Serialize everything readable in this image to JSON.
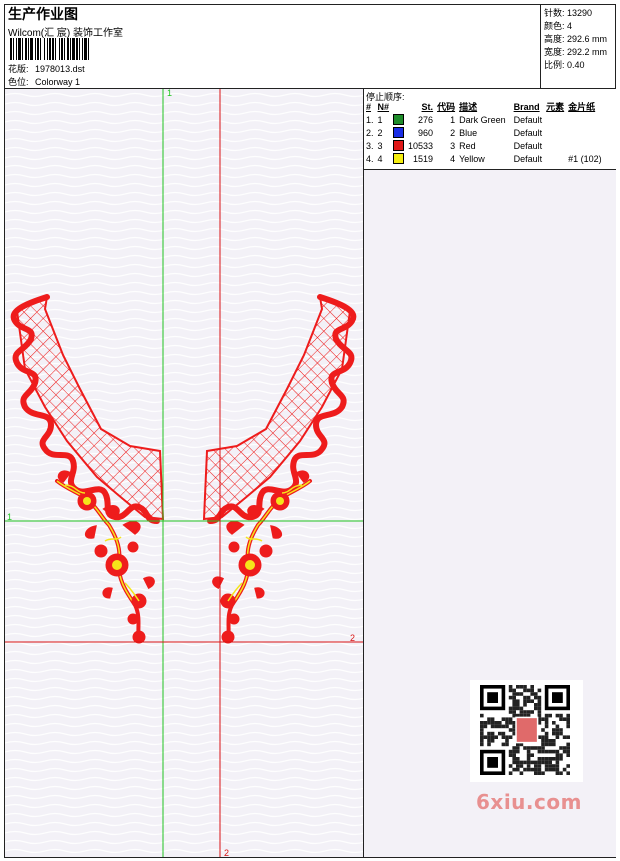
{
  "header": {
    "title": "生产作业图",
    "studio": "Wilcom(汇 宸) 装饰工作室",
    "design_label": "花版:",
    "design_value": "1978013.dst",
    "colorway_label": "色位:",
    "colorway_value": "Colorway 1"
  },
  "stats": {
    "stitches_label": "针数:",
    "stitches": "13290",
    "colors_label": "颜色:",
    "colors": "4",
    "height_label": "高度:",
    "height": "292.6 mm",
    "width_label": "宽度:",
    "width": "292.2 mm",
    "scale_label": "比例:",
    "scale": "0.40"
  },
  "stop_sequence": {
    "title": "停止顺序:",
    "headers": [
      "#",
      "N#",
      "",
      "St.",
      "代码",
      "描述",
      "Brand",
      "元素",
      "金片纸"
    ],
    "rows": [
      {
        "idx": "1.",
        "n": "1",
        "color": "#1e8c2a",
        "st": "276",
        "code": "1",
        "desc": "Dark Green",
        "brand": "Default",
        "elem": "",
        "seq": ""
      },
      {
        "idx": "2.",
        "n": "2",
        "color": "#1a2de6",
        "st": "960",
        "code": "2",
        "desc": "Blue",
        "brand": "Default",
        "elem": "",
        "seq": ""
      },
      {
        "idx": "3.",
        "n": "3",
        "color": "#e01818",
        "st": "10533",
        "code": "3",
        "desc": "Red",
        "brand": "Default",
        "elem": "",
        "seq": ""
      },
      {
        "idx": "4.",
        "n": "4",
        "color": "#f5ee10",
        "st": "1519",
        "code": "4",
        "desc": "Yellow",
        "brand": "Default",
        "elem": "",
        "seq": "#1 (102)"
      }
    ]
  },
  "guides": {
    "v1_label": "1",
    "h1_label": "1",
    "h2_label": "2",
    "v2_label": "2",
    "green": "#22c422",
    "red": "#d81414"
  },
  "colors": {
    "red": "#ee1c1c",
    "yellow": "#f5e51a",
    "canvas": "#f3f1f7"
  },
  "watermark": "6xiu.com"
}
